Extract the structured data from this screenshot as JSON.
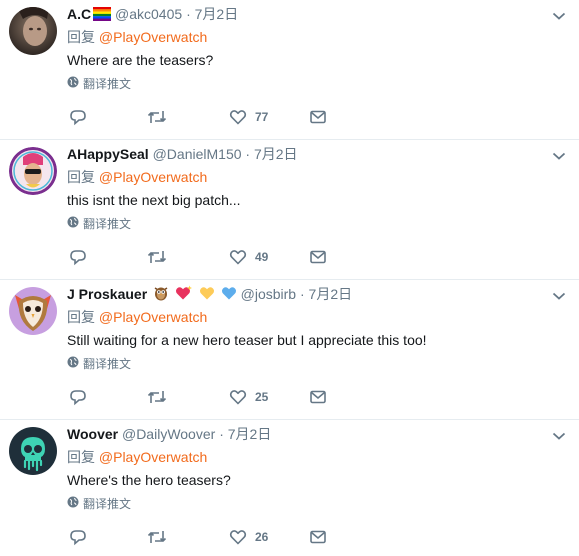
{
  "labels": {
    "reply_prefix": "回复",
    "translate": "翻译推文",
    "dot": "·"
  },
  "tweets": [
    {
      "name": "A.C",
      "handle": "@akc0405",
      "time": "7月2日",
      "reply_to": "@PlayOverwatch",
      "text": "Where are the teasers?",
      "likes": "77"
    },
    {
      "name": "AHappySeal",
      "handle": "@DanielM150",
      "time": "7月2日",
      "reply_to": "@PlayOverwatch",
      "text": "this isnt the next big patch...",
      "likes": "49"
    },
    {
      "name": "J Proskauer",
      "handle": "@josbirb",
      "time": "7月2日",
      "reply_to": "@PlayOverwatch",
      "text": "Still waiting for a new hero teaser but I appreciate this too!",
      "likes": "25"
    },
    {
      "name": "Woover",
      "handle": "@DailyWoover",
      "time": "7月2日",
      "reply_to": "@PlayOverwatch",
      "text": "Where's the hero teasers?",
      "likes": "26"
    }
  ],
  "colors": {
    "mention": "#f26b1d",
    "muted": "#657786",
    "text": "#14171a"
  },
  "icons": [
    "rainbow-flag-icon",
    "owl-emoji-icon",
    "sparkling-heart-icon",
    "yellow-heart-icon",
    "blue-heart-icon",
    "globe-icon",
    "reply-icon",
    "retweet-icon",
    "heart-icon",
    "message-icon",
    "chevron-down-icon"
  ]
}
